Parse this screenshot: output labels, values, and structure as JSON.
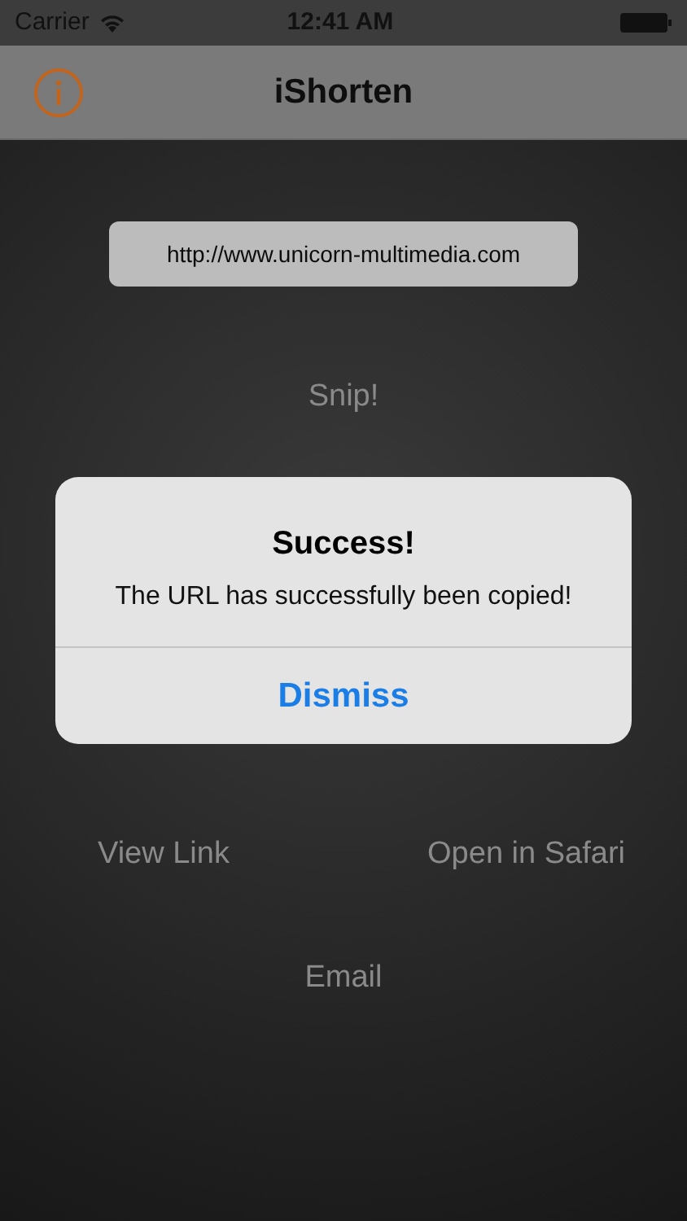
{
  "status_bar": {
    "carrier": "Carrier",
    "time": "12:41 AM"
  },
  "nav_bar": {
    "title": "iShorten"
  },
  "url_field": {
    "value": "http://www.unicorn-multimedia.com"
  },
  "snip_button": "Snip!",
  "actions": [
    {
      "label": "View Link"
    },
    {
      "label": "Open in Safari"
    }
  ],
  "email_button": "Email",
  "alert": {
    "title": "Success!",
    "message": "The URL has successfully been copied!",
    "button": "Dismiss"
  }
}
